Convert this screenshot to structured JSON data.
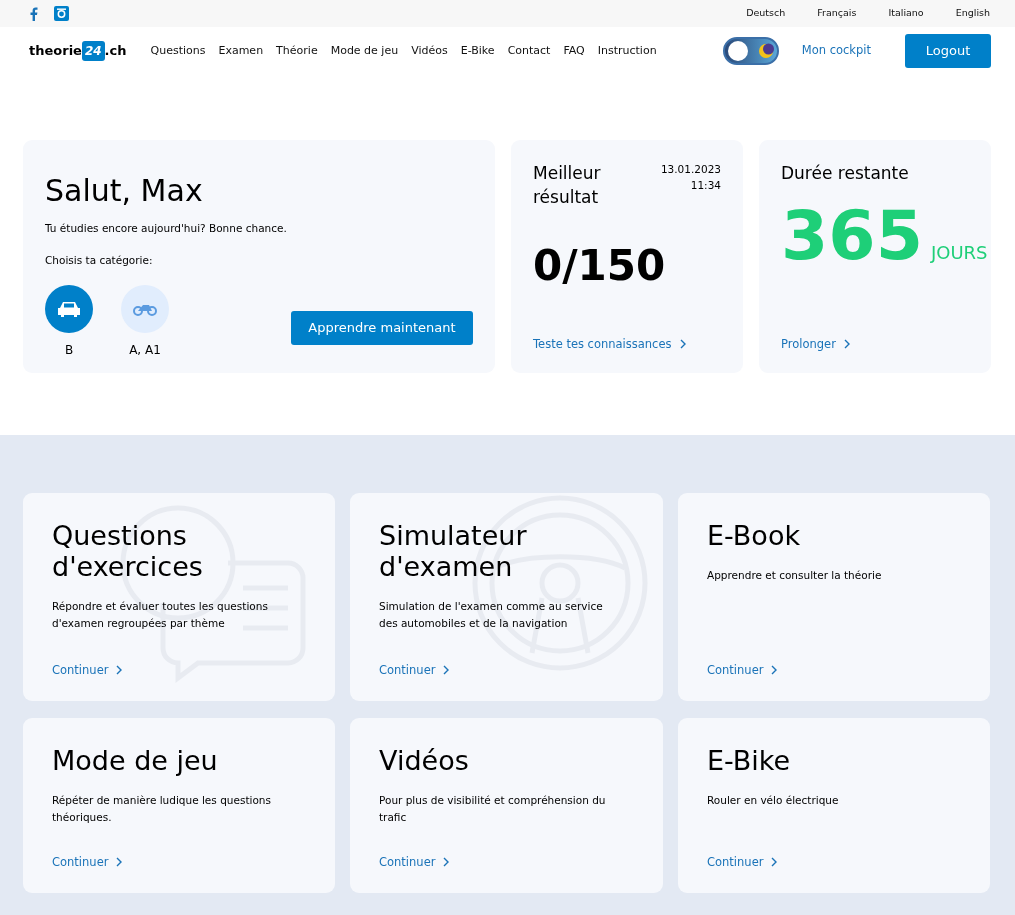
{
  "languages": [
    {
      "label": "Deutsch"
    },
    {
      "label": "Français"
    },
    {
      "label": "Italiano"
    },
    {
      "label": "English"
    }
  ],
  "brand": {
    "prefix": "theorie",
    "badge": "24",
    "suffix": ".ch"
  },
  "nav": [
    "Questions",
    "Examen",
    "Théorie",
    "Mode de jeu",
    "Vidéos",
    "E-Bike",
    "Contact",
    "FAQ",
    "Instruction"
  ],
  "dark_mode_toggle": {
    "on": false
  },
  "cockpit_link": "Mon cockpit",
  "logout_button": "Logout",
  "welcome": {
    "title": "Salut, Max",
    "subtitle": "Tu étudies encore aujourd'hui? Bonne chance.",
    "category_prompt": "Choisis ta catégorie:",
    "categories": [
      {
        "kind": "car",
        "label": "B",
        "selected": true
      },
      {
        "kind": "motorcycle",
        "label": "A, A1",
        "selected": false
      }
    ],
    "button": "Apprendre maintenant"
  },
  "best_result": {
    "title": "Meilleur résultat",
    "date": "13.01.2023",
    "time": "11:34",
    "score": "0/150",
    "link": "Teste tes connaissances"
  },
  "remaining": {
    "title": "Durée restante",
    "value": "365",
    "unit": "JOURS",
    "link": "Prolonger"
  },
  "features": [
    {
      "kind": "questions",
      "title": "Questions d'exercices",
      "text": "Répondre et évaluer toutes les questions d'examen regroupées par thème",
      "link": "Continuer"
    },
    {
      "kind": "simulator",
      "title": "Simulateur d'examen",
      "text": "Simulation de l'examen comme au service des automobiles et de la navigation",
      "link": "Continuer"
    },
    {
      "kind": "plain",
      "title": "E-Book",
      "text": "Apprendre et consulter la théorie",
      "link": "Continuer"
    },
    {
      "kind": "plain",
      "title": "Mode de jeu",
      "text": "Répéter de manière ludique les questions théoriques.",
      "link": "Continuer"
    },
    {
      "kind": "plain",
      "title": "Vidéos",
      "text": "Pour plus de visibilité et compréhension du trafic",
      "link": "Continuer"
    },
    {
      "kind": "plain",
      "title": "E-Bike",
      "text": "Rouler en vélo électrique",
      "link": "Continuer"
    }
  ]
}
